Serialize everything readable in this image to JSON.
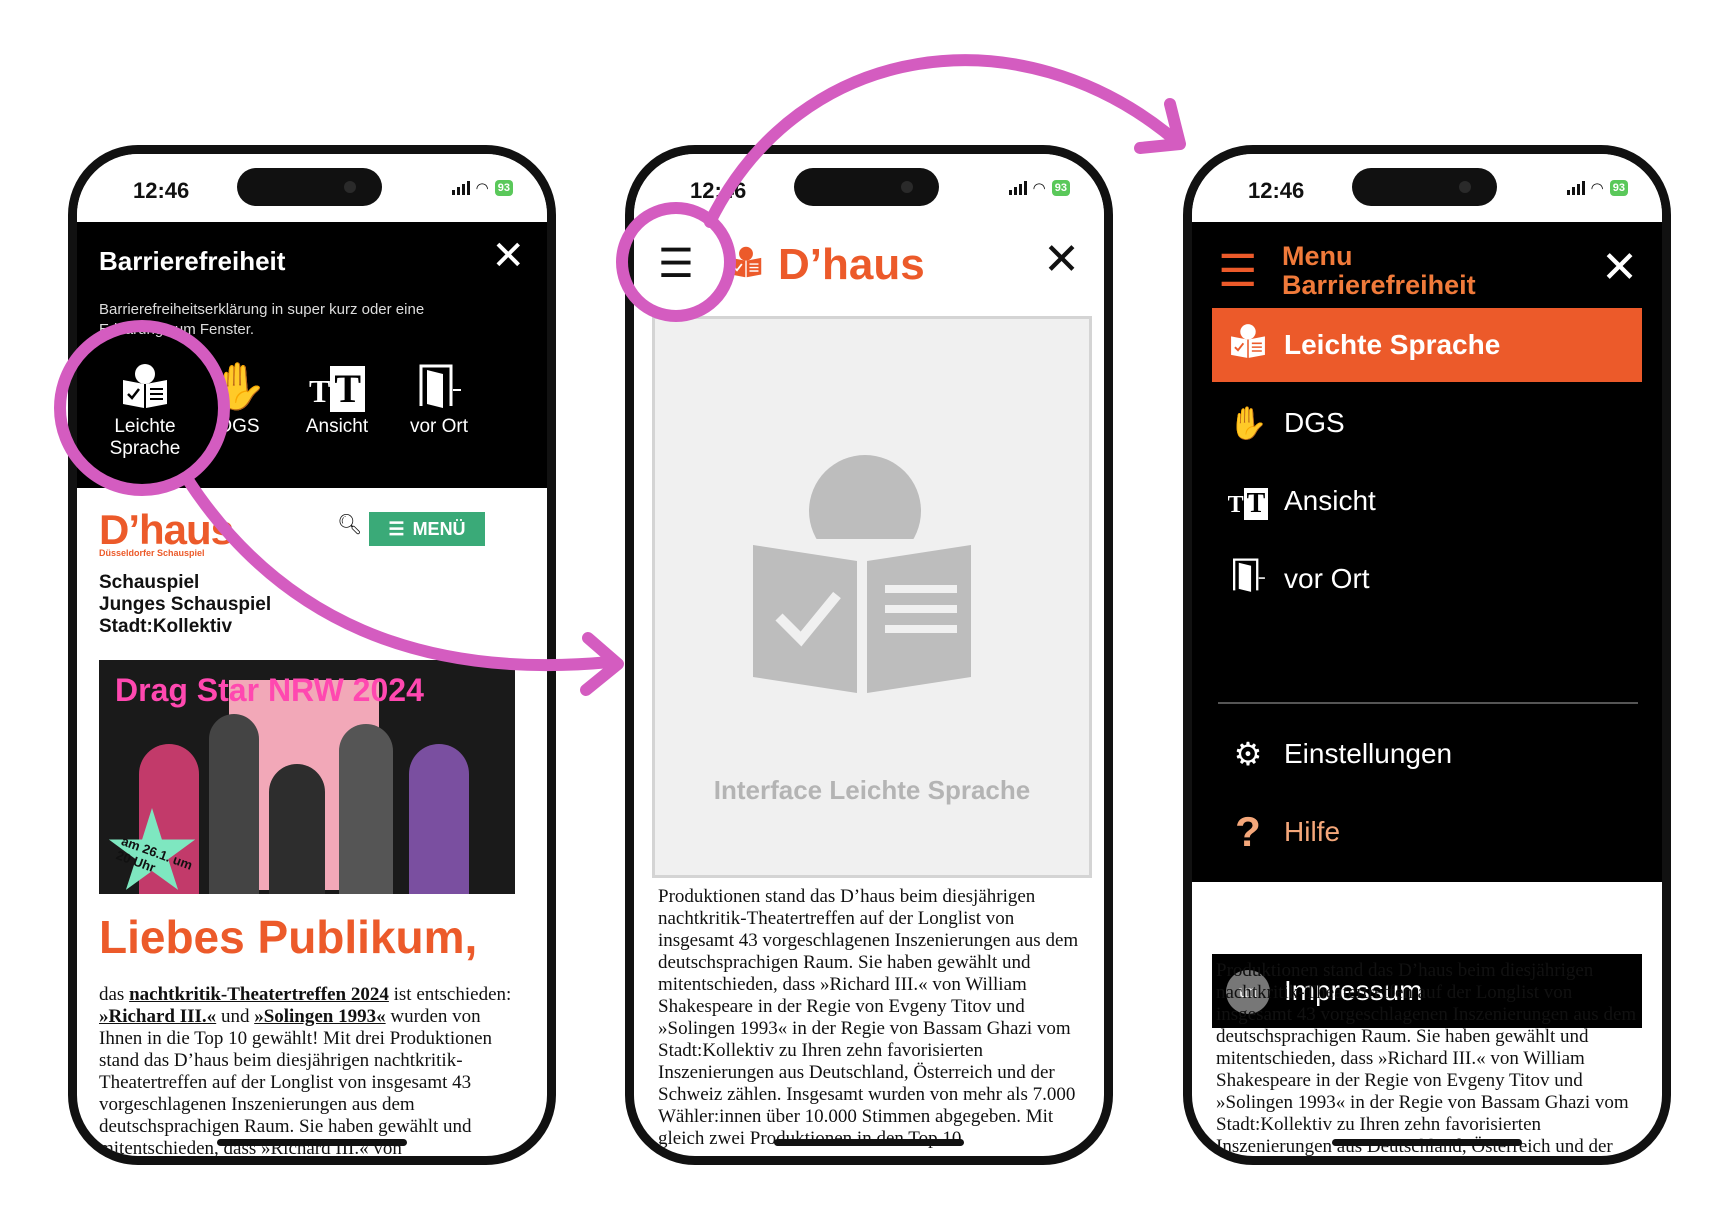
{
  "status": {
    "time": "12:46",
    "battery": "93"
  },
  "phone1": {
    "title": "Barrierefreiheit",
    "description": "Barrierefreiheitserklärung in super kurz oder eine Erklärung zum Fenster.",
    "icons": [
      {
        "label_line1": "Leichte",
        "label_line2": "Sprache",
        "icon": "easy-language-icon"
      },
      {
        "label": "DGS",
        "icon": "sign-language-icon"
      },
      {
        "label": "Ansicht",
        "icon": "text-size-icon"
      },
      {
        "label": "vor Ort",
        "icon": "door-icon"
      }
    ],
    "logo": "D’haus",
    "logo_sub": "Düsseldorfer Schauspiel",
    "menu_button": "MENÜ",
    "nav": [
      "Schauspiel",
      "Junges Schauspiel",
      "Stadt:Kollektiv"
    ],
    "hero_title": "Drag Star NRW 2024",
    "hero_badge": "am 26.1. um 20 Uhr",
    "headline": "Liebes Publikum,",
    "body": {
      "t1": "das ",
      "link1": "nachtkritik-Theatertreffen 2024",
      "t2": " ist entschieden: ",
      "link2": "»Richard III.«",
      "t3": " und ",
      "link3": "»Solingen 1993«",
      "t4": " wurden von Ihnen in die Top 10 gewählt! Mit drei Produktionen stand das D’haus beim diesjährigen nachtkritik-Theatertreffen auf der Longlist von insgesamt 43 vorgeschlagenen Inszenierungen aus dem deutschsprachigen Raum. Sie haben gewählt und mitentschieden, dass »Richard III.« von"
    }
  },
  "phone2": {
    "brand": "D’haus",
    "panel_caption": "Interface Leichte Sprache",
    "body": "Produktionen stand das D’haus beim diesjährigen nachtkritik-Theatertreffen auf der Longlist von insgesamt 43 vorgeschlagenen Inszenierungen aus dem deutschsprachigen Raum. Sie haben gewählt und mitentschieden, dass »Richard III.« von William Shakespeare in der Regie von Evgeny Titov und »Solingen 1993« in der Regie von Bassam Ghazi vom Stadt:Kollektiv zu Ihren zehn favorisierten Inszenierungen aus Deutschland, Österreich und der Schweiz zählen. Insgesamt wurden von mehr als 7.000 Wähler:innen über 10.000 Stimmen abgegeben. Mit gleich zwei Produktionen in den Top 10"
  },
  "phone3": {
    "menu_title_1": "Menu",
    "menu_title_2": "Barrierefreiheit",
    "items": [
      {
        "label": "Leichte Sprache",
        "icon": "easy-language-icon"
      },
      {
        "label": "DGS",
        "icon": "sign-language-icon"
      },
      {
        "label": "Ansicht",
        "icon": "text-size-icon"
      },
      {
        "label": "vor Ort",
        "icon": "door-icon"
      },
      {
        "label": "Einstellungen",
        "icon": "gear-icon"
      },
      {
        "label": "Hilfe",
        "icon": "help-icon"
      },
      {
        "label": "Impressum",
        "icon": "un-label-icon"
      }
    ],
    "un_label_text": "un",
    "body": "Produktionen stand das D’haus beim diesjährigen nachtkritik-Theatertreffen auf der Longlist von insgesamt 43 vorgeschlagenen Inszenierungen aus dem deutschsprachigen Raum. Sie haben gewählt und mitentschieden, dass »Richard III.« von William Shakespeare in der Regie von Evgeny Titov und »Solingen 1993« in der Regie von Bassam Ghazi vom Stadt:Kollektiv zu Ihren zehn favorisierten Inszenierungen aus Deutschland, Österreich und der Schweiz zählen. Insgesamt wurden von mehr als 7.000 Wähler:innen über 10.000 Stimmen abgegeben. Mit gleich zwei Produktionen in den Top 10"
  },
  "colors": {
    "accent": "#ec5a2a",
    "highlight": "#d45cc0",
    "menu_green": "#3aaa78"
  }
}
